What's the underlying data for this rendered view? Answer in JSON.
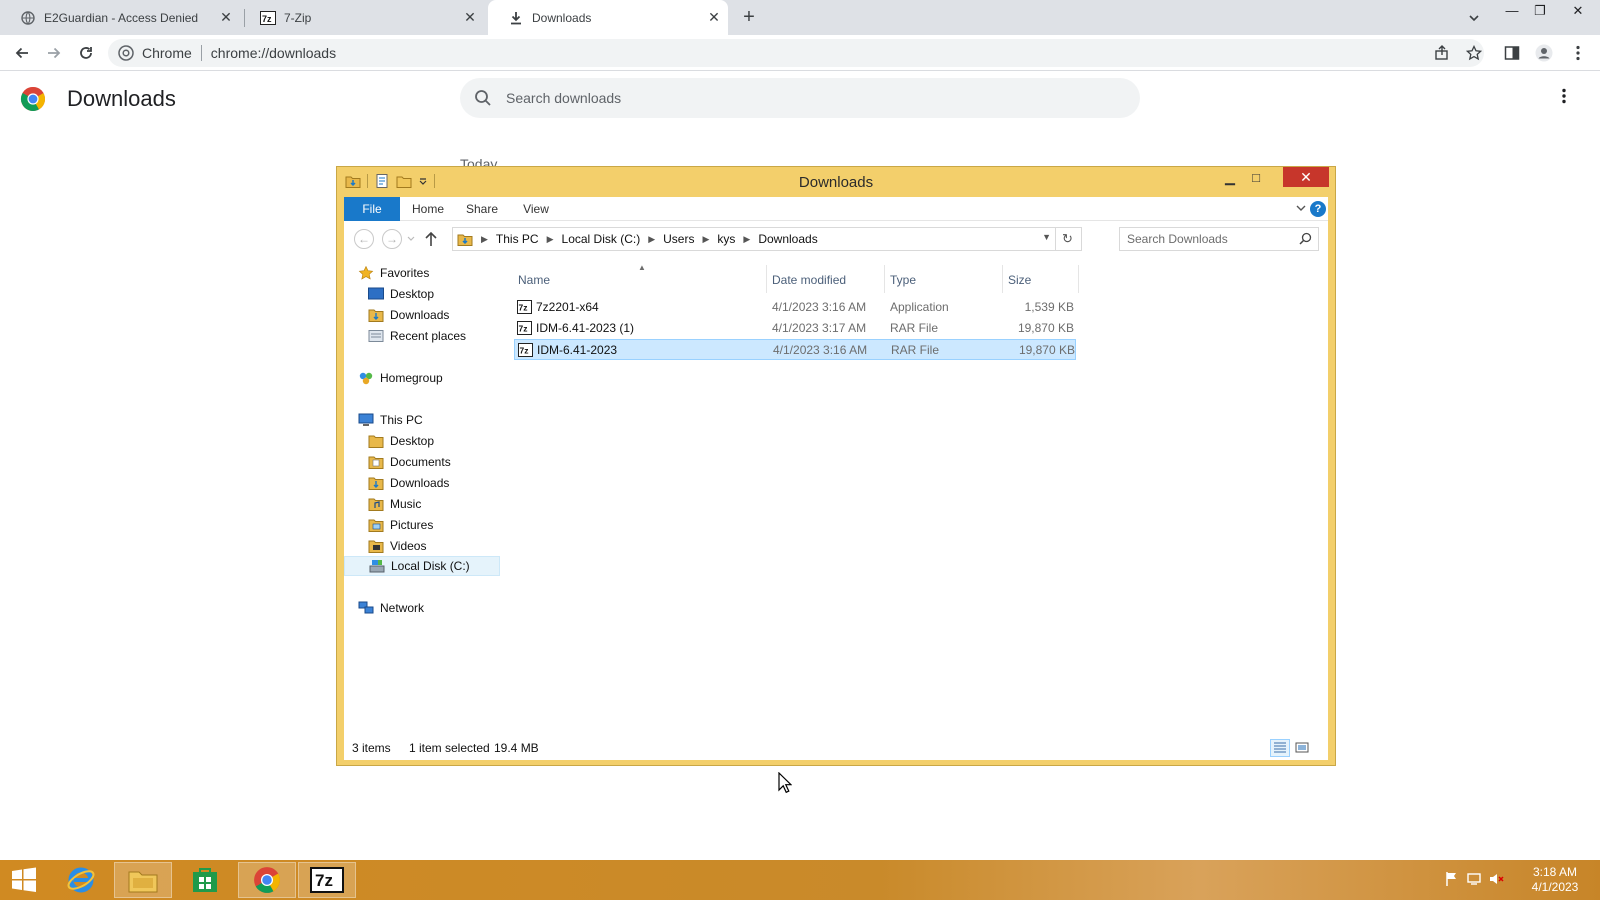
{
  "browser": {
    "tabs": [
      {
        "label": "E2Guardian - Access Denied",
        "icon": "globe-icon",
        "active": false
      },
      {
        "label": "7-Zip",
        "icon": "7zip-icon",
        "active": false
      },
      {
        "label": "Downloads",
        "icon": "download-icon",
        "active": true
      }
    ],
    "omnibox": {
      "site_label": "Chrome",
      "url": "chrome://downloads"
    }
  },
  "downloads_page": {
    "title": "Downloads",
    "search_placeholder": "Search downloads",
    "section_label": "Today"
  },
  "explorer": {
    "title": "Downloads",
    "ribbon_tabs": [
      "File",
      "Home",
      "Share",
      "View"
    ],
    "help_label": "?",
    "breadcrumb": [
      "This PC",
      "Local Disk (C:)",
      "Users",
      "kys",
      "Downloads"
    ],
    "search_placeholder": "Search Downloads",
    "nav": {
      "favorites": "Favorites",
      "favorites_items": [
        "Desktop",
        "Downloads",
        "Recent places"
      ],
      "homegroup": "Homegroup",
      "this_pc": "This PC",
      "this_pc_items": [
        "Desktop",
        "Documents",
        "Downloads",
        "Music",
        "Pictures",
        "Videos",
        "Local Disk (C:)"
      ],
      "network": "Network"
    },
    "columns": {
      "name": "Name",
      "date": "Date modified",
      "type": "Type",
      "size": "Size"
    },
    "files": [
      {
        "name": "7z2201-x64",
        "date": "4/1/2023 3:16 AM",
        "type": "Application",
        "size": "1,539 KB",
        "selected": false
      },
      {
        "name": "IDM-6.41-2023 (1)",
        "date": "4/1/2023 3:17 AM",
        "type": "RAR File",
        "size": "19,870 KB",
        "selected": false
      },
      {
        "name": "IDM-6.41-2023",
        "date": "4/1/2023 3:16 AM",
        "type": "RAR File",
        "size": "19,870 KB",
        "selected": true
      }
    ],
    "status": {
      "items": "3 items",
      "selected": "1 item selected",
      "size": "19.4 MB"
    }
  },
  "taskbar": {
    "clock_time": "3:18 AM",
    "clock_date": "4/1/2023"
  },
  "colors": {
    "explorer_frame": "#f3cf6b",
    "ribbon_file_tab": "#1979ca",
    "selection": "#cce8ff",
    "taskbar": "#d08a22",
    "close_button": "#c7362b"
  }
}
